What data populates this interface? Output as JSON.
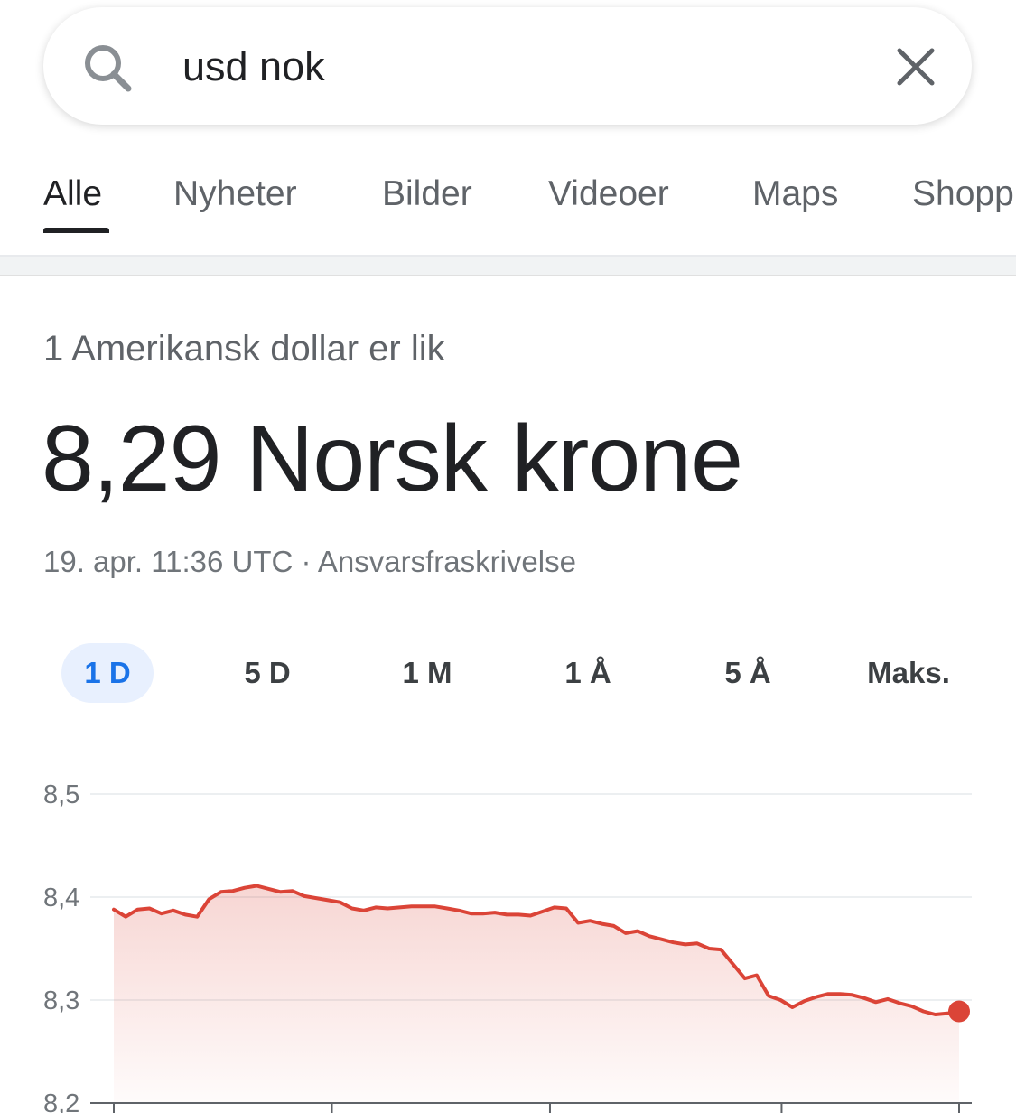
{
  "search": {
    "query": "usd nok",
    "icon": "search-icon",
    "clear_icon": "close-icon"
  },
  "tabs": [
    {
      "label": "Alle",
      "active": true
    },
    {
      "label": "Nyheter",
      "active": false
    },
    {
      "label": "Bilder",
      "active": false
    },
    {
      "label": "Videoer",
      "active": false
    },
    {
      "label": "Maps",
      "active": false
    },
    {
      "label": "Shopp",
      "active": false
    }
  ],
  "converter": {
    "subtitle": "1 Amerikansk dollar er lik",
    "rate": "8,29 Norsk krone",
    "timestamp": "19. apr. 11:36 UTC",
    "separator": " · ",
    "disclaimer": "Ansvarsfraskrivelse"
  },
  "ranges": [
    {
      "label": "1 D",
      "active": true
    },
    {
      "label": "5 D",
      "active": false
    },
    {
      "label": "1 M",
      "active": false
    },
    {
      "label": "1 Å",
      "active": false
    },
    {
      "label": "5 Å",
      "active": false
    },
    {
      "label": "Maks.",
      "active": false
    }
  ],
  "colors": {
    "line": "#db4437",
    "active_range_bg": "#e8f0fe",
    "active_range_text": "#1a73e8"
  },
  "chart_data": {
    "type": "line",
    "ylim": [
      8.2,
      8.5
    ],
    "y_ticks": [
      "8,5",
      "8,4",
      "8,3",
      "8,2"
    ],
    "y_tick_values": [
      8.5,
      8.4,
      8.3,
      8.2
    ],
    "grid": true,
    "series": [
      {
        "values": [
          8.388,
          8.381,
          8.388,
          8.389,
          8.384,
          8.387,
          8.383,
          8.381,
          8.398,
          8.405,
          8.406,
          8.409,
          8.411,
          8.408,
          8.405,
          8.406,
          8.401,
          8.399,
          8.397,
          8.395,
          8.389,
          8.387,
          8.39,
          8.389,
          8.39,
          8.391,
          8.391,
          8.391,
          8.389,
          8.387,
          8.384,
          8.384,
          8.385,
          8.383,
          8.383,
          8.382,
          8.386,
          8.39,
          8.389,
          8.375,
          8.377,
          8.374,
          8.372,
          8.365,
          8.367,
          8.362,
          8.359,
          8.356,
          8.354,
          8.355,
          8.35,
          8.349,
          8.335,
          8.321,
          8.324,
          8.304,
          8.3,
          8.293,
          8.299,
          8.303,
          8.306,
          8.306,
          8.305,
          8.302,
          8.298,
          8.301,
          8.297,
          8.294,
          8.289,
          8.286,
          8.287,
          8.289
        ]
      }
    ]
  }
}
